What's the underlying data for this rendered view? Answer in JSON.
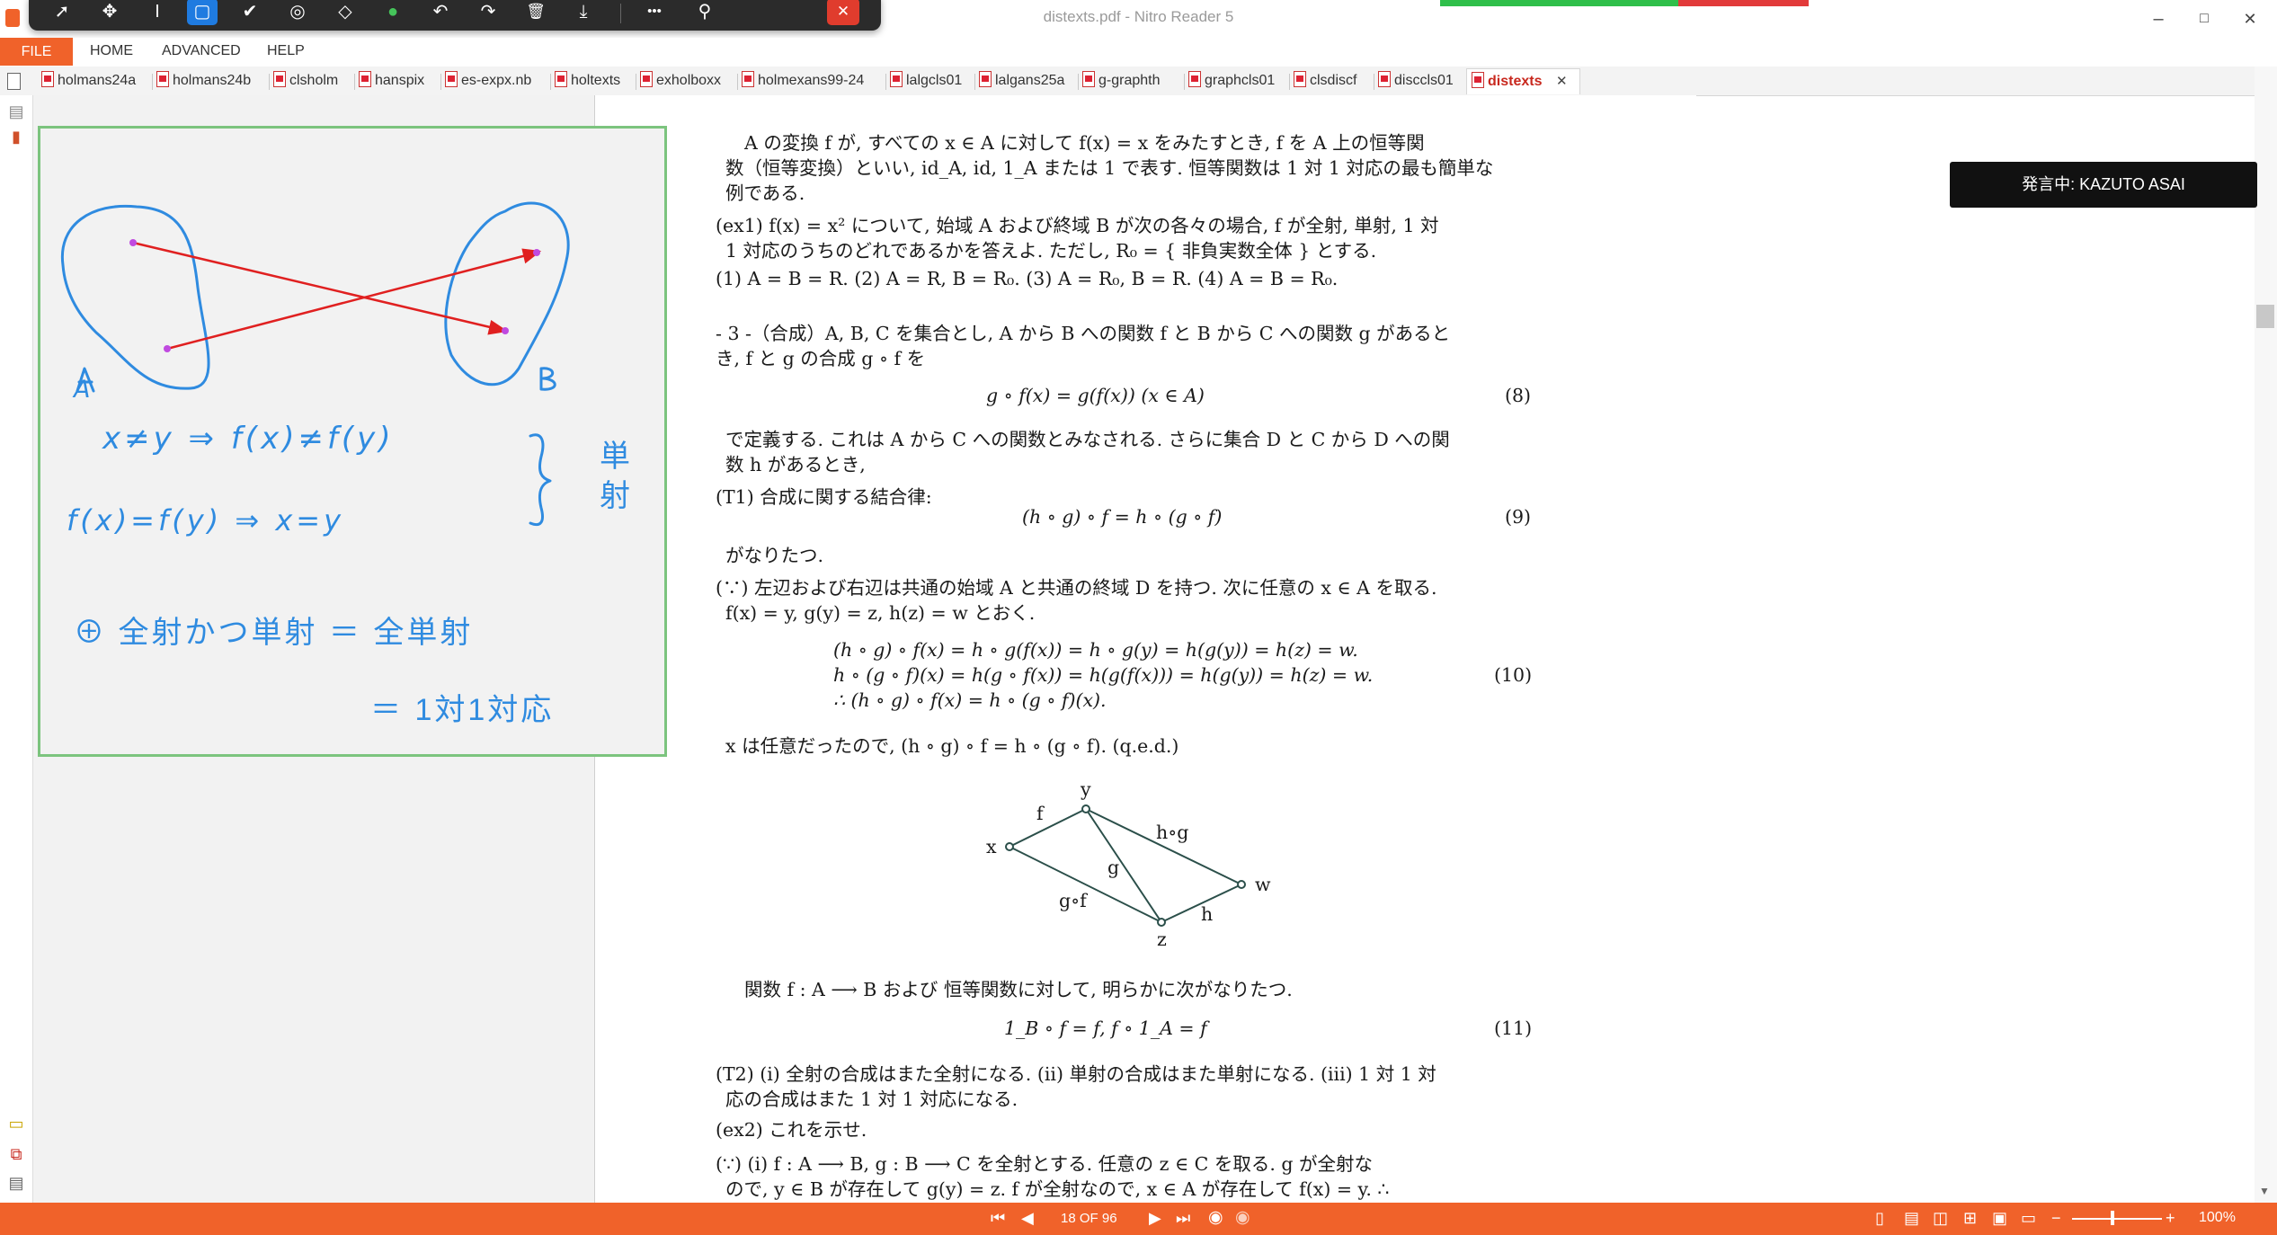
{
  "window": {
    "title": "distexts.pdf - Nitro Reader 5",
    "minimize_glyph": "–",
    "restore_glyph": "□",
    "close_glyph": "✕"
  },
  "annotation_toolbar": {
    "tools": [
      "select-arrow-icon",
      "move-icon",
      "text-cursor-icon",
      "rectangle-icon",
      "check-icon",
      "stamp-icon",
      "eraser-icon",
      "green-color-icon",
      "undo-icon",
      "redo-icon",
      "delete-icon",
      "download-icon",
      "more-icon",
      "participants-icon",
      "close-icon"
    ],
    "glyphs": [
      "➚",
      "✥",
      "I",
      "▢",
      "✔",
      "◎",
      "◇",
      "●",
      "↶",
      "↷",
      "🗑",
      "⤓",
      "•••",
      "⚲",
      "✕"
    ]
  },
  "menu": {
    "file": "FILE",
    "home": "HOME",
    "advanced": "ADVANCED",
    "help": "HELP"
  },
  "tabs": [
    "holmans24a",
    "holmans24b",
    "clsholm",
    "hanspix",
    "es-expx.nb",
    "holtexts",
    "exholboxx",
    "holmexans99-24",
    "lalgcls01",
    "lalgans25a",
    "g-graphth",
    "graphcls01",
    "clsdiscf",
    "disccls01",
    "distexts"
  ],
  "active_tab_close": "✕",
  "speaking": "発言中: KAZUTO ASAI",
  "whiteboard": {
    "label_a": "A",
    "label_b": "B",
    "line1": "x≠y ⇒ f(x)≠f(y)",
    "line2": "f(x)=f(y) ⇒ x=y",
    "kanji_top": "単",
    "kanji_bottom": "射",
    "line3": "⊕ 全射かつ単射 ＝ 全単射",
    "line4": "＝ 1対1対応"
  },
  "document": {
    "p1a": "A の変換 f が, すべての x ∈ A に対して f(x) = x をみたすとき, f を A 上の恒等関",
    "p1b": "数（恒等変換）といい, id_A, id, 1_A または 1 で表す. 恒等関数は 1 対 1 対応の最も簡単な",
    "p1c": "例である.",
    "ex1a": "(ex1)  f(x) = x² について, 始域 A および終域 B が次の各々の場合, f が全射, 単射, 1 対",
    "ex1b": "1 対応のうちのどれであるかを答えよ. ただし, R₀ = { 非負実数全体 } とする.",
    "ex1c": "(1)  A = B = R.   (2)  A = R, B = R₀.   (3)  A = R₀, B = R.   (4)  A = B = R₀.",
    "s3a": "- 3 -（合成）A, B, C を集合とし, A から B への関数 f と B から C への関数 g があると",
    "s3b": "き, f と g の合成 g ∘ f を",
    "eq8": "g ∘ f(x) = g(f(x))        (x ∈ A)",
    "eq8no": "(8)",
    "p2a": "で定義する. これは A から C への関数とみなされる. さらに集合 D と C から D への関",
    "p2b": "数 h があるとき,",
    "t1": "(T1)  合成に関する結合律:",
    "eq9": "(h ∘ g) ∘ f = h ∘ (g ∘ f)",
    "eq9no": "(9)",
    "p3": "がなりたつ.",
    "pf1a": "(∵)  左辺および右辺は共通の始域 A と共通の終域 D を持つ. 次に任意の x ∈ A を取る.",
    "pf1b": "f(x) = y, g(y) = z, h(z) = w とおく.",
    "eq10a": "(h ∘ g) ∘ f(x) = h ∘ g(f(x)) = h ∘ g(y) = h(g(y)) = h(z) = w.",
    "eq10b": "h ∘ (g ∘ f)(x) = h(g ∘ f(x)) = h(g(f(x))) = h(g(y)) = h(z) = w.",
    "eq10c": "∴  (h ∘ g) ∘ f(x) = h ∘ (g ∘ f)(x).",
    "eq10no": "(10)",
    "qed": "x は任意だったので, (h ∘ g) ∘ f = h ∘ (g ∘ f).   (q.e.d.)",
    "diag": {
      "x": "x",
      "y": "y",
      "z": "z",
      "w": "w",
      "f": "f",
      "g": "g",
      "h": "h",
      "hog": "h∘g",
      "gof": "g∘f"
    },
    "p4": "関数 f : A ⟶ B および 恒等関数に対して, 明らかに次がなりたつ.",
    "eq11": "1_B ∘ f = f,        f ∘ 1_A = f",
    "eq11no": "(11)",
    "t2a": "(T2)  (i)  全射の合成はまた全射になる.   (ii)  単射の合成はまた単射になる.   (iii)  1 対 1 対",
    "t2b": "応の合成はまた 1 対 1 対応になる.",
    "ex2": "(ex2)  これを示せ.",
    "pf2a": "(∵)  (i)  f : A ⟶ B,  g : B ⟶ C を全射とする.  任意の z ∈ C を取る.  g が全射な",
    "pf2b": "ので, y ∈ B が存在して g(y) = z.  f が全射なので, x ∈ A が存在して f(x) = y.    ∴"
  },
  "status": {
    "page_counter": "18 OF 96",
    "zoom": "100%",
    "zoom_minus": "−",
    "zoom_plus": "+"
  },
  "colors": {
    "accent": "#f0622a",
    "whiteboard_frame": "#7cc47e",
    "ink_blue": "#2f8be0",
    "ink_red": "#e02020",
    "speaking_bg": "#111111",
    "rec_green": "#2fbf4a",
    "rec_red": "#e23a3a"
  }
}
